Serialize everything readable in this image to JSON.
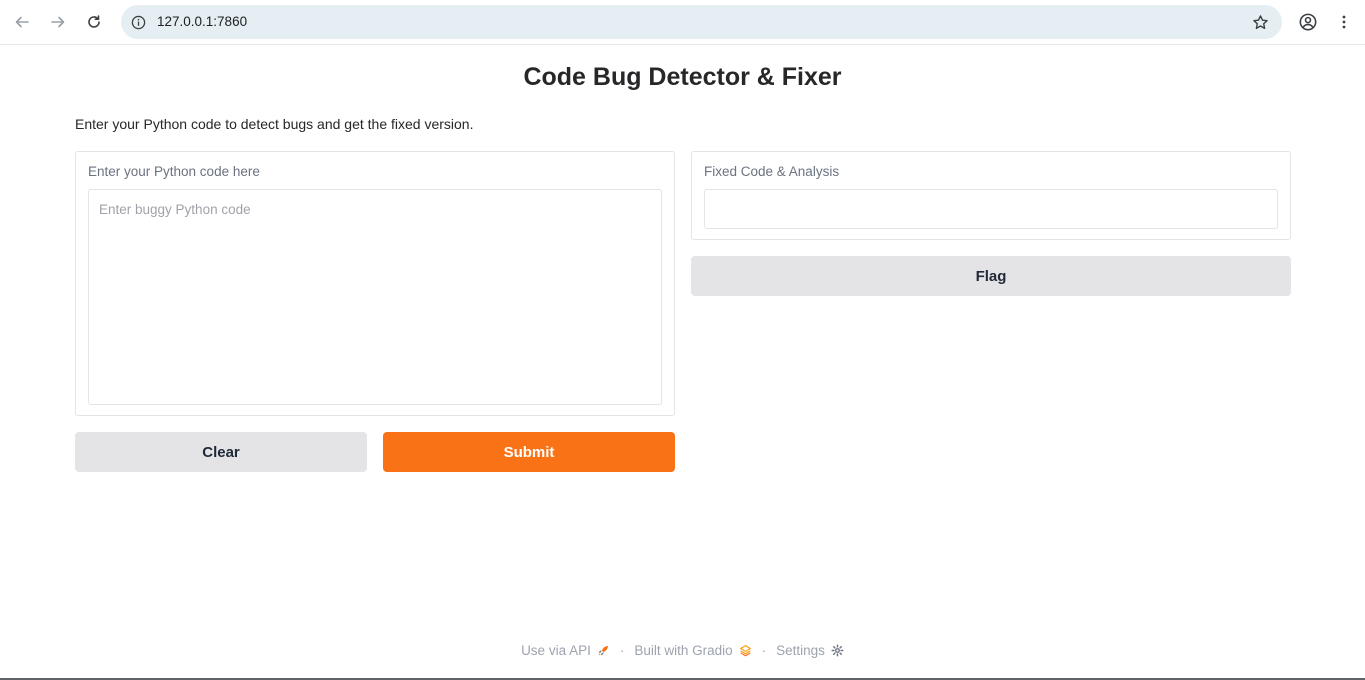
{
  "browser": {
    "url": "127.0.0.1:7860"
  },
  "app": {
    "title": "Code Bug Detector & Fixer",
    "description": "Enter your Python code to detect bugs and get the fixed version."
  },
  "input_panel": {
    "label": "Enter your Python code here",
    "placeholder": "Enter buggy Python code"
  },
  "output_panel": {
    "label": "Fixed Code & Analysis",
    "value": ""
  },
  "buttons": {
    "clear": "Clear",
    "submit": "Submit",
    "flag": "Flag"
  },
  "footer": {
    "api": "Use via API",
    "built": "Built with Gradio",
    "settings": "Settings",
    "separator": "·"
  },
  "colors": {
    "primary": "#f97316",
    "secondary": "#e4e4e7"
  }
}
